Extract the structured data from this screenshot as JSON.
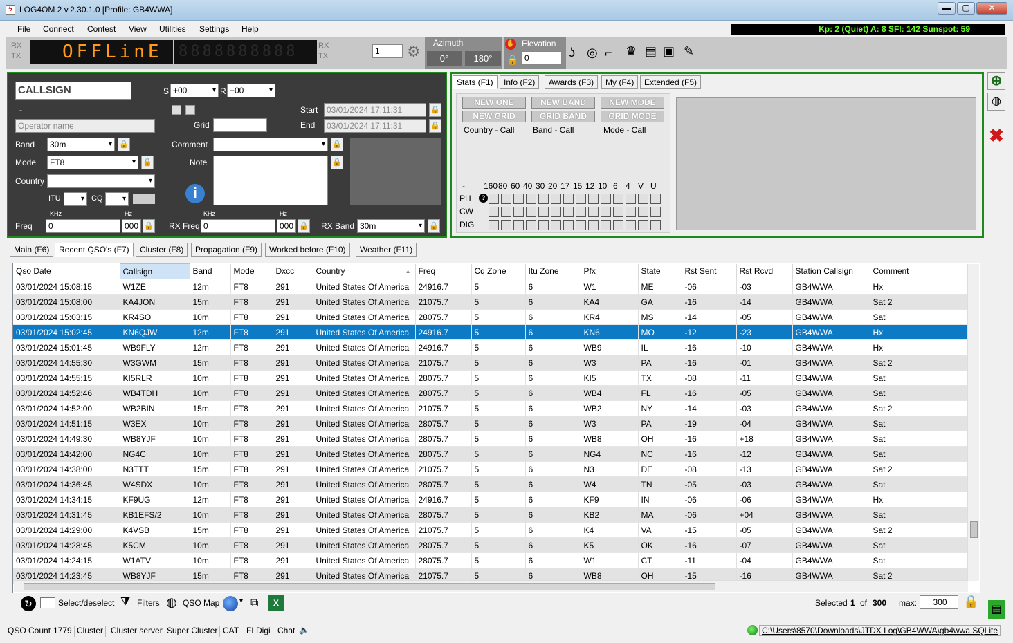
{
  "window": {
    "title": "LOG4OM 2 v.2.30.1.0 [Profile: GB4WWA]",
    "min": "▬",
    "max": "▢",
    "close": "✕"
  },
  "menu": [
    "File",
    "Connect",
    "Contest",
    "View",
    "Utilities",
    "Settings",
    "Help"
  ],
  "propagation": "Kp: 2 (Quiet)  A: 8  SFI: 142 Sunspot: 59",
  "toolbar": {
    "rx": "RX",
    "tx": "TX",
    "led_main": "OFFLinE",
    "led_sub": "8888888888",
    "rx2": "RX",
    "tx2": "TX",
    "spinner": "1",
    "azimuth_label": "Azimuth",
    "az1": "0°",
    "az2": "180°",
    "elevation_label": "Elevation",
    "elevation_value": "0"
  },
  "entry": {
    "callsign_placeholder": "CALLSIGN",
    "dash": "-",
    "operator_placeholder": "Operator name",
    "s_label": "S",
    "s_value": "+00",
    "r_label": "R",
    "r_value": "+00",
    "start_label": "Start",
    "start_value": "03/01/2024 17:11:31",
    "end_label": "End",
    "end_value": "03/01/2024 17:11:31",
    "grid_label": "Grid",
    "band_label": "Band",
    "band_value": "30m",
    "mode_label": "Mode",
    "mode_value": "FT8",
    "country_label": "Country",
    "comment_label": "Comment",
    "note_label": "Note",
    "itu_label": "ITU",
    "cq_label": "CQ",
    "khz": "KHz",
    "hz": "Hz",
    "freq_label": "Freq",
    "freq_value": "0",
    "freq_hz": "000",
    "rxfreq_label": "RX Freq",
    "rxfreq_value": "0",
    "rxfreq_hz": "000",
    "rxband_label": "RX Band",
    "rxband_value": "30m"
  },
  "stats_tabs": [
    "Stats (F1)",
    "Info (F2)",
    "Awards (F3)",
    "My (F4)",
    "Extended (F5)"
  ],
  "stats": {
    "btn1": "NEW ONE",
    "btn2": "NEW BAND",
    "btn3": "NEW MODE",
    "btn4": "NEW GRID",
    "btn5": "GRID BAND",
    "btn6": "GRID MODE",
    "cap1": "Country - Call",
    "cap2": "Band - Call",
    "cap3": "Mode - Call",
    "dash": "-",
    "bands": [
      "160",
      "80",
      "60",
      "40",
      "30",
      "20",
      "17",
      "15",
      "12",
      "10",
      "6",
      "4",
      "V",
      "U"
    ],
    "rows": [
      "PH",
      "CW",
      "DIG"
    ],
    "help": "?"
  },
  "main_tabs": [
    "Main (F6)",
    "Recent QSO's (F7)",
    "Cluster (F8)",
    "Propagation (F9)",
    "Worked before (F10)",
    "Weather (F11)"
  ],
  "columns": [
    "Qso Date",
    "Callsign",
    "Band",
    "Mode",
    "Dxcc",
    "Country",
    "Freq",
    "Cq Zone",
    "Itu Zone",
    "Pfx",
    "State",
    "Rst Sent",
    "Rst Rcvd",
    "Station Callsign",
    "Comment"
  ],
  "rows": [
    [
      "03/01/2024 15:08:15",
      "W1ZE",
      "12m",
      "FT8",
      "291",
      "United States Of America",
      "24916.7",
      "5",
      "6",
      "W1",
      "ME",
      "-06",
      "-03",
      "GB4WWA",
      "Hx"
    ],
    [
      "03/01/2024 15:08:00",
      "KA4JON",
      "15m",
      "FT8",
      "291",
      "United States Of America",
      "21075.7",
      "5",
      "6",
      "KA4",
      "GA",
      "-16",
      "-14",
      "GB4WWA",
      "Sat 2"
    ],
    [
      "03/01/2024 15:03:15",
      "KR4SO",
      "10m",
      "FT8",
      "291",
      "United States Of America",
      "28075.7",
      "5",
      "6",
      "KR4",
      "MS",
      "-14",
      "-05",
      "GB4WWA",
      "Sat"
    ],
    [
      "03/01/2024 15:02:45",
      "KN6QJW",
      "12m",
      "FT8",
      "291",
      "United States Of America",
      "24916.7",
      "5",
      "6",
      "KN6",
      "MO",
      "-12",
      "-23",
      "GB4WWA",
      "Hx"
    ],
    [
      "03/01/2024 15:01:45",
      "WB9FLY",
      "12m",
      "FT8",
      "291",
      "United States Of America",
      "24916.7",
      "5",
      "6",
      "WB9",
      "IL",
      "-16",
      "-10",
      "GB4WWA",
      "Hx"
    ],
    [
      "03/01/2024 14:55:30",
      "W3GWM",
      "15m",
      "FT8",
      "291",
      "United States Of America",
      "21075.7",
      "5",
      "6",
      "W3",
      "PA",
      "-16",
      "-01",
      "GB4WWA",
      "Sat 2"
    ],
    [
      "03/01/2024 14:55:15",
      "KI5RLR",
      "10m",
      "FT8",
      "291",
      "United States Of America",
      "28075.7",
      "5",
      "6",
      "KI5",
      "TX",
      "-08",
      "-11",
      "GB4WWA",
      "Sat"
    ],
    [
      "03/01/2024 14:52:46",
      "WB4TDH",
      "10m",
      "FT8",
      "291",
      "United States Of America",
      "28075.7",
      "5",
      "6",
      "WB4",
      "FL",
      "-16",
      "-05",
      "GB4WWA",
      "Sat"
    ],
    [
      "03/01/2024 14:52:00",
      "WB2BIN",
      "15m",
      "FT8",
      "291",
      "United States Of America",
      "21075.7",
      "5",
      "6",
      "WB2",
      "NY",
      "-14",
      "-03",
      "GB4WWA",
      "Sat 2"
    ],
    [
      "03/01/2024 14:51:15",
      "W3EX",
      "10m",
      "FT8",
      "291",
      "United States Of America",
      "28075.7",
      "5",
      "6",
      "W3",
      "PA",
      "-19",
      "-04",
      "GB4WWA",
      "Sat"
    ],
    [
      "03/01/2024 14:49:30",
      "WB8YJF",
      "10m",
      "FT8",
      "291",
      "United States Of America",
      "28075.7",
      "5",
      "6",
      "WB8",
      "OH",
      "-16",
      "+18",
      "GB4WWA",
      "Sat"
    ],
    [
      "03/01/2024 14:42:00",
      "NG4C",
      "10m",
      "FT8",
      "291",
      "United States Of America",
      "28075.7",
      "5",
      "6",
      "NG4",
      "NC",
      "-16",
      "-12",
      "GB4WWA",
      "Sat"
    ],
    [
      "03/01/2024 14:38:00",
      "N3TTT",
      "15m",
      "FT8",
      "291",
      "United States Of America",
      "21075.7",
      "5",
      "6",
      "N3",
      "DE",
      "-08",
      "-13",
      "GB4WWA",
      "Sat 2"
    ],
    [
      "03/01/2024 14:36:45",
      "W4SDX",
      "10m",
      "FT8",
      "291",
      "United States Of America",
      "28075.7",
      "5",
      "6",
      "W4",
      "TN",
      "-05",
      "-03",
      "GB4WWA",
      "Sat"
    ],
    [
      "03/01/2024 14:34:15",
      "KF9UG",
      "12m",
      "FT8",
      "291",
      "United States Of America",
      "24916.7",
      "5",
      "6",
      "KF9",
      "IN",
      "-06",
      "-06",
      "GB4WWA",
      "Hx"
    ],
    [
      "03/01/2024 14:31:45",
      "KB1EFS/2",
      "10m",
      "FT8",
      "291",
      "United States Of America",
      "28075.7",
      "5",
      "6",
      "KB2",
      "MA",
      "-06",
      "+04",
      "GB4WWA",
      "Sat"
    ],
    [
      "03/01/2024 14:29:00",
      "K4VSB",
      "15m",
      "FT8",
      "291",
      "United States Of America",
      "21075.7",
      "5",
      "6",
      "K4",
      "VA",
      "-15",
      "-05",
      "GB4WWA",
      "Sat 2"
    ],
    [
      "03/01/2024 14:28:45",
      "K5CM",
      "10m",
      "FT8",
      "291",
      "United States Of America",
      "28075.7",
      "5",
      "6",
      "K5",
      "OK",
      "-16",
      "-07",
      "GB4WWA",
      "Sat"
    ],
    [
      "03/01/2024 14:24:15",
      "W1ATV",
      "10m",
      "FT8",
      "291",
      "United States Of America",
      "28075.7",
      "5",
      "6",
      "W1",
      "CT",
      "-11",
      "-04",
      "GB4WWA",
      "Sat"
    ],
    [
      "03/01/2024 14:23:45",
      "WB8YJF",
      "15m",
      "FT8",
      "291",
      "United States Of America",
      "21075.7",
      "5",
      "6",
      "WB8",
      "OH",
      "-15",
      "-16",
      "GB4WWA",
      "Sat 2"
    ]
  ],
  "selected_row": 3,
  "bottom": {
    "select": "Select/deselect",
    "filters": "Filters",
    "qsomap": "QSO Map",
    "selected_label": "Selected",
    "selected_value": "1",
    "of": "of",
    "total": "300",
    "max_label": "max:",
    "max_value": "300"
  },
  "status": {
    "qso_count_label": "QSO Count",
    "qso_count": "1779",
    "items": [
      "Cluster",
      "Cluster server",
      "Super Cluster",
      "CAT",
      "FLDigi",
      "Chat"
    ],
    "db_path": "C:\\Users\\8570\\Downloads\\JTDX Log\\GB4WWA\\gb4wwa.SQLite"
  },
  "colors": {
    "accent": "#1e8a1e",
    "selection": "#0c7ac4",
    "led": "#ff9a1a"
  }
}
